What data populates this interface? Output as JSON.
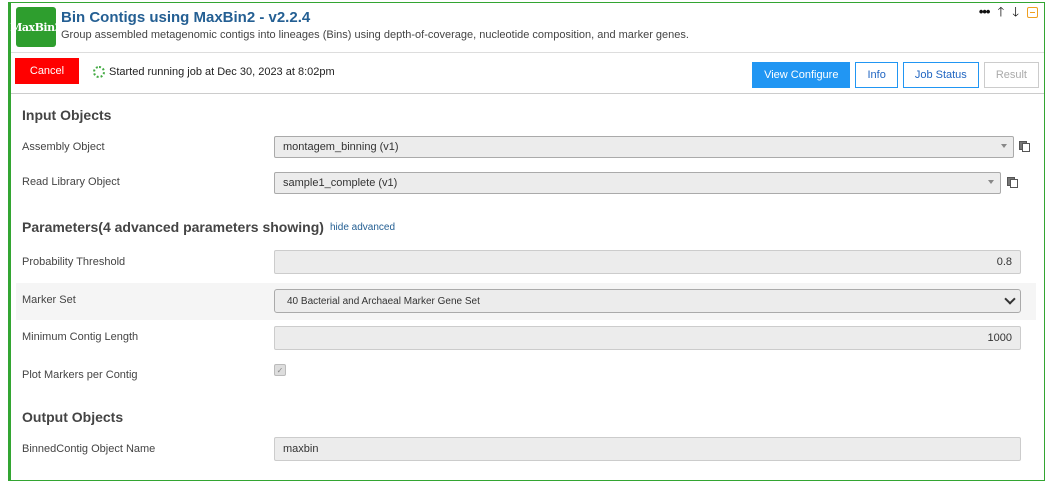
{
  "header": {
    "logo_text": "MaxBin2",
    "title": "Bin Contigs using MaxBin2 - v2.2.4",
    "subtitle": "Group assembled metagenomic contigs into lineages (Bins) using depth-of-coverage, nucleotide composition, and marker genes."
  },
  "toolbar": {
    "cancel_label": "Cancel",
    "status_text": "Started running job at Dec 30, 2023 at 8:02pm",
    "tabs": [
      {
        "label": "View Configure",
        "state": "active"
      },
      {
        "label": "Info",
        "state": "normal"
      },
      {
        "label": "Job Status",
        "state": "normal"
      },
      {
        "label": "Result",
        "state": "disabled"
      }
    ]
  },
  "input_objects": {
    "heading": "Input Objects",
    "assembly": {
      "label": "Assembly Object",
      "value": "montagem_binning (v1)"
    },
    "read_library": {
      "label": "Read Library Object",
      "value": "sample1_complete (v1)"
    }
  },
  "parameters": {
    "heading": "Parameters(4 advanced parameters showing)",
    "hide_advanced": "hide advanced",
    "probability_threshold": {
      "label": "Probability Threshold",
      "value": "0.8"
    },
    "marker_set": {
      "label": "Marker Set",
      "value": "40 Bacterial and Archaeal Marker Gene Set"
    },
    "min_contig_length": {
      "label": "Minimum Contig Length",
      "value": "1000"
    },
    "plot_markers": {
      "label": "Plot Markers per Contig",
      "checked": true
    }
  },
  "output_objects": {
    "heading": "Output Objects",
    "binned_contig": {
      "label": "BinnedContig Object Name",
      "value": "maxbin"
    }
  },
  "colors": {
    "accent": "#2196f3",
    "border": "#33a532",
    "cancel": "#ff0000",
    "title": "#245f93"
  }
}
